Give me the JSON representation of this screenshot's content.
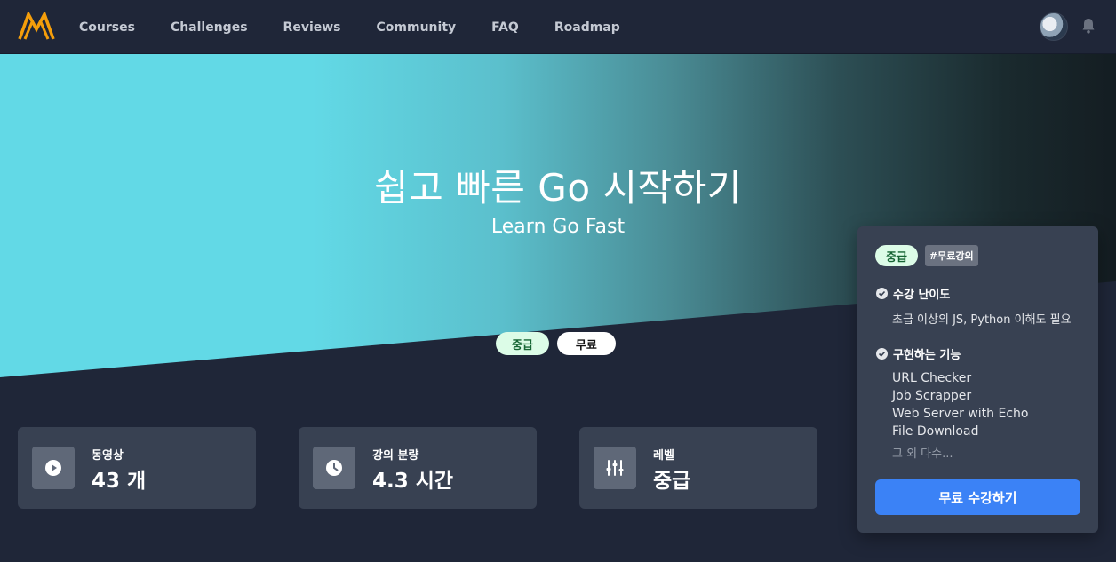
{
  "nav": {
    "links": [
      "Courses",
      "Challenges",
      "Reviews",
      "Community",
      "FAQ",
      "Roadmap"
    ],
    "brand_color": "#f59e0b"
  },
  "hero": {
    "title": "쉽고 빠른 Go 시작하기",
    "subtitle": "Learn Go Fast",
    "tags": [
      "중급",
      "무료"
    ]
  },
  "stats": [
    {
      "icon": "play-icon",
      "label": "동영상",
      "value": "43 개"
    },
    {
      "icon": "clock-icon",
      "label": "강의 분량",
      "value": "4.3 시간"
    },
    {
      "icon": "sliders-icon",
      "label": "레벨",
      "value": "중급"
    }
  ],
  "sidebar": {
    "level_tag": "중급",
    "hash_tag": "#무료강의",
    "difficulty_heading": "수강 난이도",
    "difficulty_text": "초급 이상의 JS, Python 이해도 필요",
    "features_heading": "구현하는 기능",
    "features": [
      "URL Checker",
      "Job Scrapper",
      "Web Server with Echo",
      "File Download"
    ],
    "more": "그 외 다수...",
    "cta": "무료 수강하기"
  }
}
